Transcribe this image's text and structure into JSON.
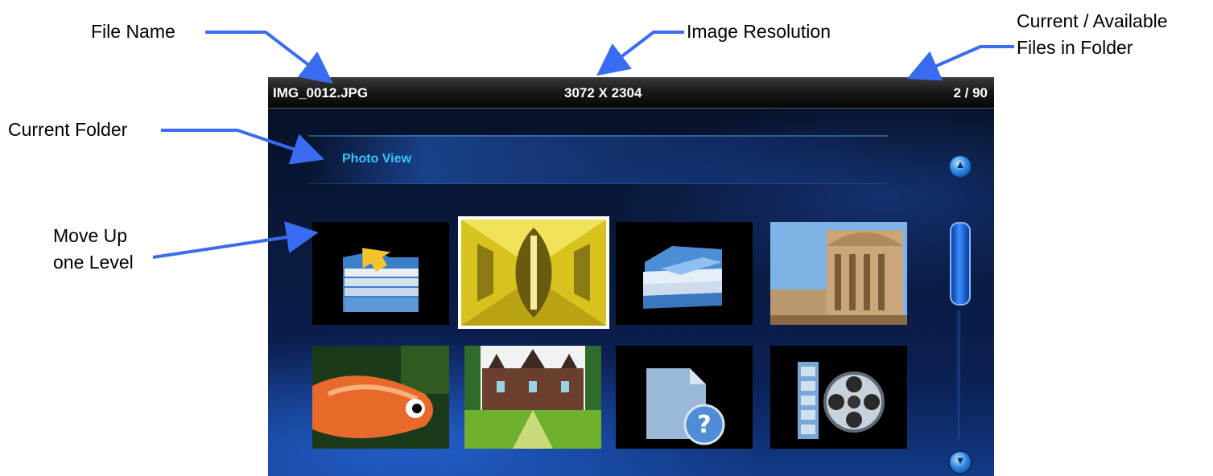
{
  "callouts": {
    "file_name": "File Name",
    "image_resolution": "Image Resolution",
    "current_available_line1": "Current / Available",
    "current_available_line2": "Files in Folder",
    "current_folder": "Current Folder",
    "move_up_line1": "Move Up",
    "move_up_line2": "one Level"
  },
  "status_bar": {
    "file_name": "IMG_0012.JPG",
    "resolution": "3072 X 2304",
    "position": "2 / 90"
  },
  "folder": {
    "name": "Photo View"
  },
  "tiles": [
    {
      "icon": "folder-up-icon",
      "selected": false
    },
    {
      "icon": "photo-thumbnail",
      "selected": true
    },
    {
      "icon": "folder-icon",
      "selected": false
    },
    {
      "icon": "photo-thumbnail",
      "selected": false
    },
    {
      "icon": "photo-thumbnail",
      "selected": false
    },
    {
      "icon": "photo-thumbnail",
      "selected": false
    },
    {
      "icon": "unknown-file-icon",
      "selected": false
    },
    {
      "icon": "video-file-icon",
      "selected": false
    }
  ],
  "colors": {
    "arrow": "#3a6cf2",
    "folder_label": "#38c4ff",
    "accent_blue": "#2f8be6"
  }
}
